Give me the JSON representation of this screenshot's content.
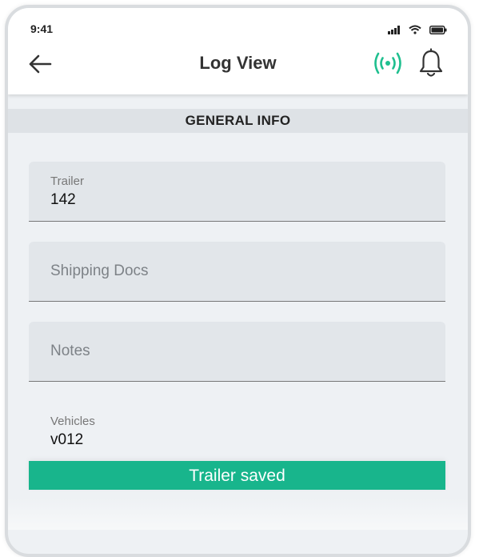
{
  "status_bar": {
    "time": "9:41",
    "icons": [
      "signal-icon",
      "wifi-icon",
      "battery-icon"
    ]
  },
  "header": {
    "title": "Log View",
    "back_icon": "back-arrow-icon",
    "connection_icon": "broadcast-icon",
    "notification_icon": "bell-icon"
  },
  "colors": {
    "accent": "#18b58c",
    "connection": "#1fbf8f"
  },
  "section": {
    "title": "GENERAL INFO"
  },
  "form": {
    "trailer": {
      "label": "Trailer",
      "value": "142"
    },
    "shipping_docs": {
      "placeholder": "Shipping Docs"
    },
    "notes": {
      "placeholder": "Notes"
    },
    "vehicles": {
      "label": "Vehicles",
      "value": "v012"
    }
  },
  "toast": {
    "message": "Trailer saved"
  }
}
